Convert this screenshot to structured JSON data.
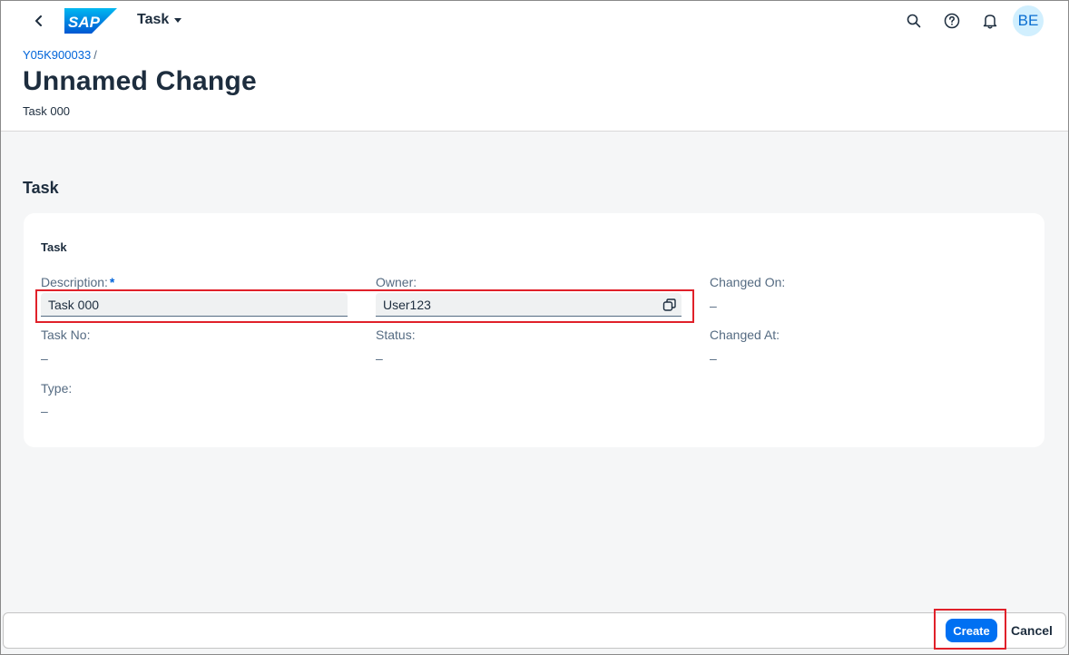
{
  "shell": {
    "app_title": "Task",
    "avatar_initials": "BE",
    "logo_text": "SAP"
  },
  "header": {
    "breadcrumb_link": "Y05K900033",
    "breadcrumb_sep": "/",
    "title": "Unnamed Change",
    "subtitle": "Task 000"
  },
  "section": {
    "title": "Task",
    "card_title": "Task"
  },
  "fields": {
    "description_label": "Description:",
    "description_required": "*",
    "description_value": "Task 000",
    "owner_label": "Owner:",
    "owner_value": "User123",
    "changed_on_label": "Changed On:",
    "changed_on_value": "–",
    "task_no_label": "Task No:",
    "task_no_value": "–",
    "status_label": "Status:",
    "status_value": "–",
    "changed_at_label": "Changed At:",
    "changed_at_value": "–",
    "type_label": "Type:",
    "type_value": "–"
  },
  "footer": {
    "create_label": "Create",
    "cancel_label": "Cancel"
  },
  "colors": {
    "accent": "#0070f2",
    "link": "#0064d9",
    "highlight": "#e0212a"
  },
  "icons": [
    "back-icon",
    "search-icon",
    "help-icon",
    "bell-icon",
    "value-help-icon"
  ]
}
